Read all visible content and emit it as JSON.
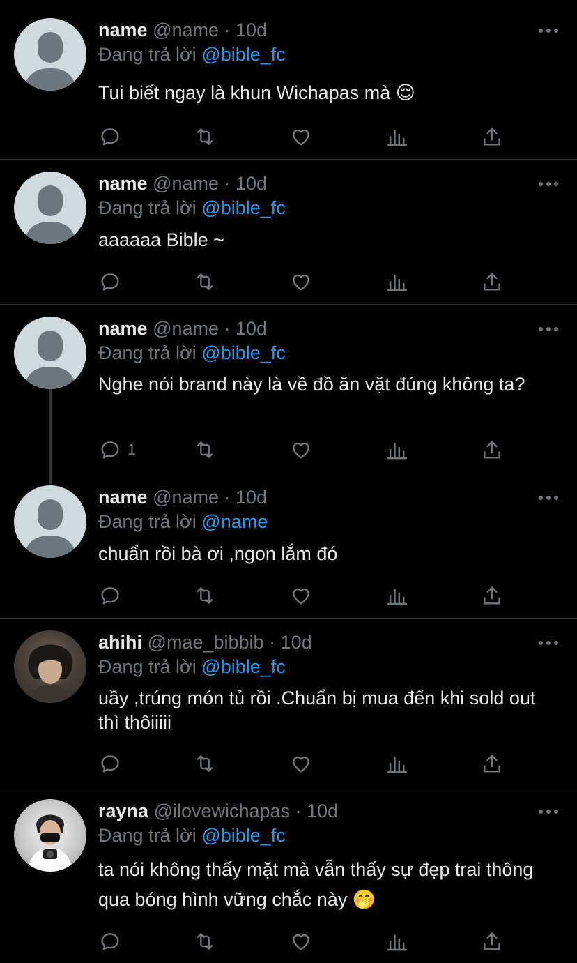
{
  "reply_prefix": "Đang trả lời",
  "tweets": [
    {
      "name": "name",
      "handle": "@name",
      "date": "· 10d",
      "reply_to": "@bible_fc",
      "text": "Tui biết ngay là khun Wichapas mà 😌",
      "reply_count": ""
    },
    {
      "name": "name",
      "handle": "@name",
      "date": "· 10d",
      "reply_to": "@bible_fc",
      "text": "aaaaaa Bible ~",
      "reply_count": ""
    },
    {
      "name": "name",
      "handle": "@name",
      "date": "· 10d",
      "reply_to": "@bible_fc",
      "text": "Nghe nói brand này là về đồ ăn vặt đúng không ta?",
      "reply_count": "1"
    },
    {
      "name": "name",
      "handle": "@name",
      "date": "· 10d",
      "reply_to": "@name",
      "text": "chuẩn rồi bà ơi ,ngon lắm đó",
      "reply_count": ""
    },
    {
      "name": "ahihi",
      "handle": "@mae_bibbib",
      "date": "· 10d",
      "reply_to": "@bible_fc",
      "text": "uầy ,trúng món tủ rồi .Chuẩn bị mua đến khi sold out thì thôiiiii",
      "reply_count": ""
    },
    {
      "name": "rayna",
      "handle": "@ilovewichapas",
      "date": "· 10d",
      "reply_to": "@bible_fc",
      "text": "ta nói không thấy mặt mà vẫn thấy sự đẹp trai thông qua bóng hình vững chắc này 🤭",
      "reply_count": ""
    }
  ],
  "icons": {
    "reply": "reply-icon",
    "retweet": "retweet-icon",
    "like": "heart-icon",
    "views": "views-icon",
    "share": "share-icon",
    "more": "more-icon",
    "default_avatar": "default-avatar-icon"
  },
  "colors": {
    "background": "#000000",
    "text": "#e7e9ea",
    "muted": "#71767b",
    "mention": "#1d9bf0",
    "divider": "#2f3336"
  }
}
